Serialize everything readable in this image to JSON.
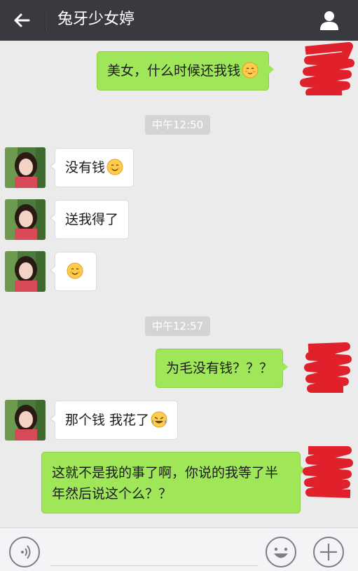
{
  "header": {
    "title": "兔牙少女婷",
    "back_icon": "arrow-left-icon",
    "profile_icon": "user-icon"
  },
  "messages": [
    {
      "side": "out",
      "text": "美女，什么时候还我钱",
      "emoji": "blush-emoji"
    },
    {
      "time": "中午12:50"
    },
    {
      "side": "in",
      "text": "没有钱",
      "emoji": "smile-emoji"
    },
    {
      "side": "in",
      "text": "送我得了"
    },
    {
      "side": "in",
      "text": "",
      "emoji": "smile-emoji"
    },
    {
      "time": "中午12:57"
    },
    {
      "side": "out",
      "text": "为毛没有钱？？？"
    },
    {
      "side": "in",
      "text": "那个钱 我花了",
      "emoji": "laugh-cry-emoji"
    },
    {
      "side": "out",
      "text": "这就不是我的事了啊，你说的我等了半年然后说这个么？？"
    }
  ],
  "input": {
    "voice_icon": "voice-icon",
    "emoji_icon": "emoji-face-icon",
    "plus_icon": "plus-icon"
  },
  "colors": {
    "header_bg": "#393a3f",
    "chat_bg": "#ebebeb",
    "outgoing_bubble": "#9fe658",
    "incoming_bubble": "#ffffff",
    "redaction": "#e0202a"
  }
}
